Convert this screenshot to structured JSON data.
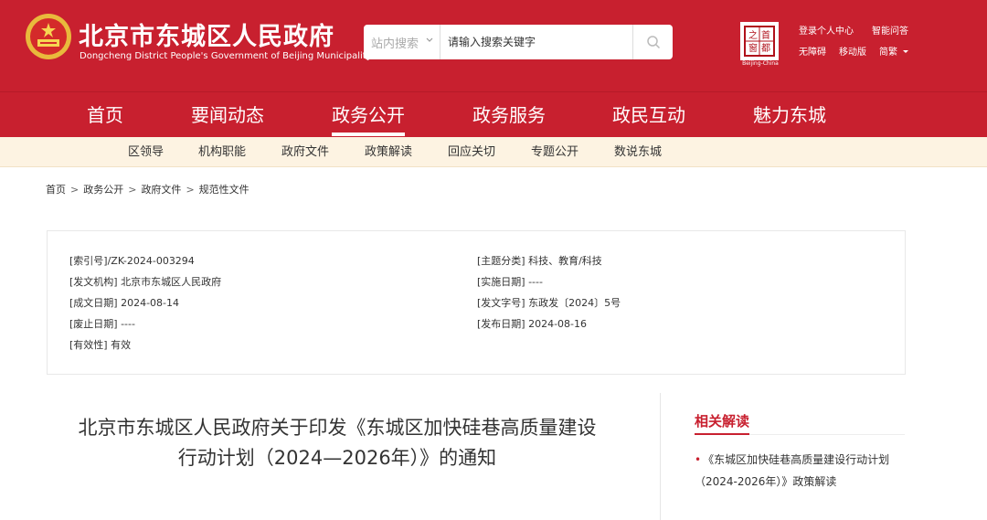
{
  "header": {
    "title_cn": "北京市东城区人民政府",
    "title_en": "Dongcheng District People's Government of Beijing Municipality",
    "brand_color": "#c8202f",
    "search": {
      "scope": "站内搜索",
      "placeholder": "请输入搜索关键字"
    },
    "logo_sub": "Beijing-China",
    "logo_chars": [
      "首",
      "都",
      "之",
      "窗"
    ],
    "links_row1": [
      "登录个人中心",
      "智能问答"
    ],
    "links_row2": [
      "无障碍",
      "移动版",
      "简繁"
    ]
  },
  "main_nav": {
    "items": [
      "首页",
      "要闻动态",
      "政务公开",
      "政务服务",
      "政民互动",
      "魅力东城"
    ],
    "active": "政务公开"
  },
  "sub_nav": {
    "items": [
      "区领导",
      "机构职能",
      "政府文件",
      "政策解读",
      "回应关切",
      "专题公开",
      "数说东城"
    ]
  },
  "breadcrumb": [
    "首页",
    "政务公开",
    "政府文件",
    "规范性文件"
  ],
  "meta": {
    "left": [
      "[索引号]/ZK-2024-003294",
      "[发文机构] 北京市东城区人民政府",
      "[成文日期] 2024-08-14",
      "[废止日期] ----",
      "[有效性] 有效"
    ],
    "right": [
      "[主题分类] 科技、教育/科技",
      "[实施日期] ----",
      "[发文字号] 东政发〔2024〕5号",
      "[发布日期] 2024-08-16"
    ]
  },
  "article": {
    "title_line1": "北京市东城区人民政府关于印发《东城区加快硅巷高质量建设",
    "title_line2": "行动计划（2024—2026年）》的通知"
  },
  "related": {
    "heading": "相关解读",
    "items": [
      "《东城区加快硅巷高质量建设行动计划（2024-2026年）》政策解读"
    ]
  }
}
